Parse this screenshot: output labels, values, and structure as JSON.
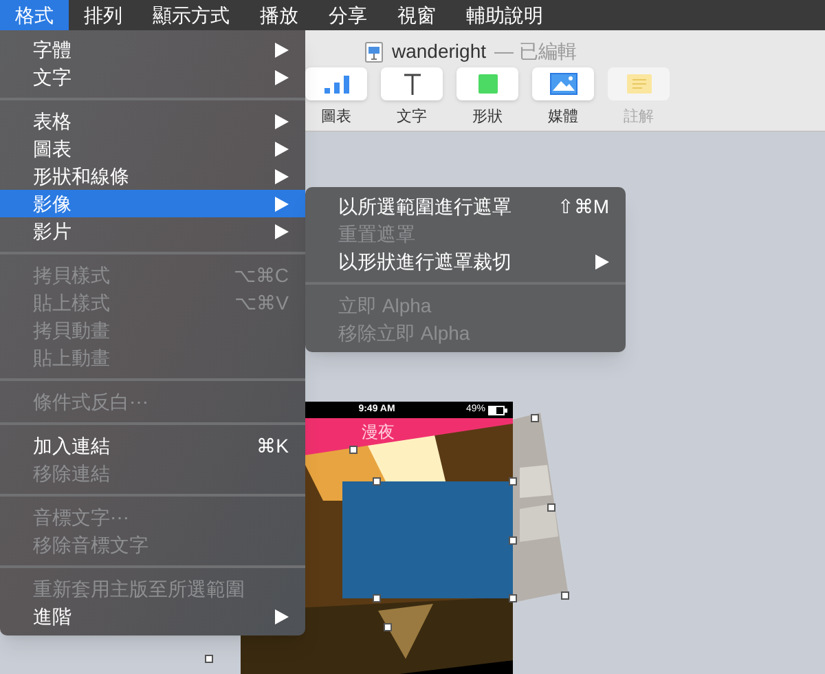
{
  "menu_bar": [
    {
      "label": "格式",
      "selected": true
    },
    {
      "label": "排列",
      "selected": false
    },
    {
      "label": "顯示方式",
      "selected": false
    },
    {
      "label": "播放",
      "selected": false
    },
    {
      "label": "分享",
      "selected": false
    },
    {
      "label": "視窗",
      "selected": false
    },
    {
      "label": "輔助說明",
      "selected": false
    }
  ],
  "window": {
    "title": "wanderight",
    "status": "— 已編輯"
  },
  "toolbar": [
    {
      "kind": "chart",
      "label": "圖表",
      "disabled": false
    },
    {
      "kind": "text",
      "label": "文字",
      "disabled": false
    },
    {
      "kind": "shape",
      "label": "形狀",
      "disabled": false
    },
    {
      "kind": "media",
      "label": "媒體",
      "disabled": false
    },
    {
      "kind": "comment",
      "label": "註解",
      "disabled": true
    }
  ],
  "format_menu": [
    {
      "kind": "item",
      "label": "字體",
      "submenu": true,
      "disabled": false,
      "selected": false
    },
    {
      "kind": "item",
      "label": "文字",
      "submenu": true,
      "disabled": false,
      "selected": false
    },
    {
      "kind": "separator"
    },
    {
      "kind": "item",
      "label": "表格",
      "submenu": true,
      "disabled": false,
      "selected": false
    },
    {
      "kind": "item",
      "label": "圖表",
      "submenu": true,
      "disabled": false,
      "selected": false
    },
    {
      "kind": "item",
      "label": "形狀和線條",
      "submenu": true,
      "disabled": false,
      "selected": false
    },
    {
      "kind": "item",
      "label": "影像",
      "submenu": true,
      "disabled": false,
      "selected": true
    },
    {
      "kind": "item",
      "label": "影片",
      "submenu": true,
      "disabled": false,
      "selected": false
    },
    {
      "kind": "separator"
    },
    {
      "kind": "item",
      "label": "拷貝樣式",
      "shortcut": "⌥⌘C",
      "submenu": false,
      "disabled": true,
      "selected": false
    },
    {
      "kind": "item",
      "label": "貼上樣式",
      "shortcut": "⌥⌘V",
      "submenu": false,
      "disabled": true,
      "selected": false
    },
    {
      "kind": "item",
      "label": "拷貝動畫",
      "submenu": false,
      "disabled": true,
      "selected": false
    },
    {
      "kind": "item",
      "label": "貼上動畫",
      "submenu": false,
      "disabled": true,
      "selected": false
    },
    {
      "kind": "separator"
    },
    {
      "kind": "item",
      "label": "條件式反白⋯",
      "submenu": false,
      "disabled": true,
      "selected": false
    },
    {
      "kind": "separator"
    },
    {
      "kind": "item",
      "label": "加入連結",
      "shortcut": "⌘K",
      "submenu": false,
      "disabled": false,
      "selected": false
    },
    {
      "kind": "item",
      "label": "移除連結",
      "submenu": false,
      "disabled": true,
      "selected": false
    },
    {
      "kind": "separator"
    },
    {
      "kind": "item",
      "label": "音標文字⋯",
      "submenu": false,
      "disabled": true,
      "selected": false
    },
    {
      "kind": "item",
      "label": "移除音標文字",
      "submenu": false,
      "disabled": true,
      "selected": false
    },
    {
      "kind": "separator"
    },
    {
      "kind": "item",
      "label": "重新套用主版至所選範圍",
      "submenu": false,
      "disabled": true,
      "selected": false
    },
    {
      "kind": "item",
      "label": "進階",
      "submenu": true,
      "disabled": false,
      "selected": false
    }
  ],
  "image_submenu": [
    {
      "kind": "item",
      "label": "以所選範圍進行遮罩",
      "shortcut": "⇧⌘M",
      "submenu": false,
      "disabled": false,
      "selected": false
    },
    {
      "kind": "item",
      "label": "重置遮罩",
      "submenu": false,
      "disabled": true,
      "selected": false
    },
    {
      "kind": "item",
      "label": "以形狀進行遮罩裁切",
      "submenu": true,
      "disabled": false,
      "selected": false
    },
    {
      "kind": "separator"
    },
    {
      "kind": "item",
      "label": "立即 Alpha",
      "submenu": false,
      "disabled": true,
      "selected": false
    },
    {
      "kind": "item",
      "label": "移除立即 Alpha",
      "submenu": false,
      "disabled": true,
      "selected": false
    }
  ],
  "slide": {
    "time": "9:49 AM",
    "battery": "49%",
    "header": "漫夜"
  }
}
